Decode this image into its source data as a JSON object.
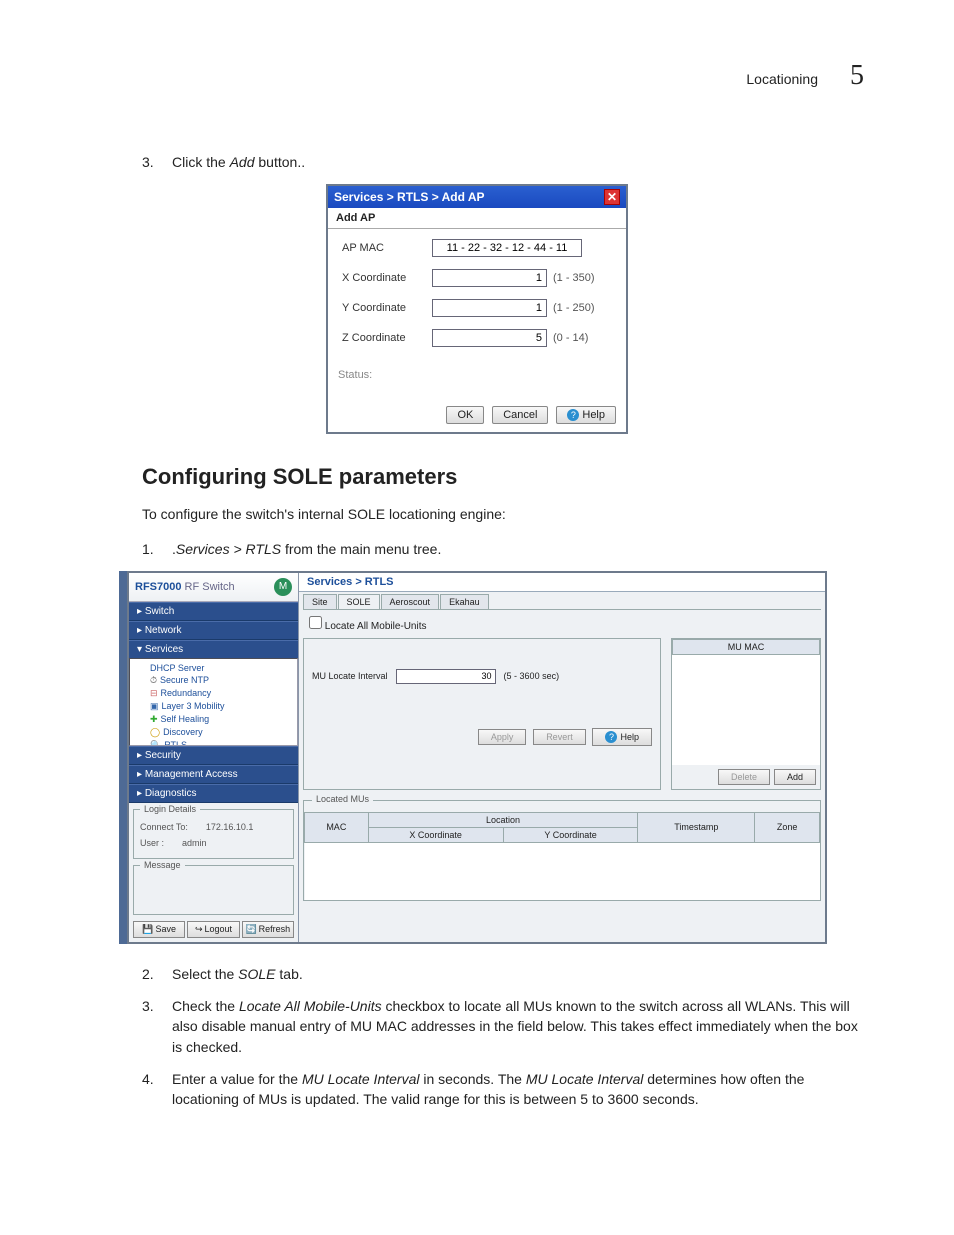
{
  "page_header": {
    "section": "Locationing",
    "chapter": "5"
  },
  "step3": {
    "num": "3.",
    "pre": "Click the ",
    "em": "Add",
    "post": " button.."
  },
  "dialog1": {
    "breadcrumb": "Services  > RTLS  > Add AP",
    "subtitle": "Add AP",
    "rows": {
      "mac": {
        "label": "AP MAC",
        "value": "11 - 22 - 32 - 12 - 44 - 11"
      },
      "x": {
        "label": "X Coordinate",
        "value": "1",
        "hint": "(1 - 350)"
      },
      "y": {
        "label": "Y Coordinate",
        "value": "1",
        "hint": "(1 - 250)"
      },
      "z": {
        "label": "Z Coordinate",
        "value": "5",
        "hint": "(0 - 14)"
      }
    },
    "status_label": "Status:",
    "buttons": {
      "ok": "OK",
      "cancel": "Cancel",
      "help": "Help"
    }
  },
  "heading": "Configuring SOLE parameters",
  "intro": "To configure the switch's internal SOLE locationing engine:",
  "step1": {
    "num": "1.",
    "pre": ".",
    "em": "Services > RTLS",
    "post": " from the main menu tree."
  },
  "panel2": {
    "brand1": "RFS7000",
    "brand2": " RF Switch",
    "nav": {
      "switch": "Switch",
      "network": "Network",
      "services": "Services",
      "security": "Security",
      "mgmt": "Management Access",
      "diag": "Diagnostics"
    },
    "tree": [
      "DHCP Server",
      "Secure NTP",
      "Redundancy",
      "Layer 3 Mobility",
      "Self Healing",
      "Discovery",
      "RTLS"
    ],
    "login": {
      "legend": "Login Details",
      "connect_lbl": "Connect To:",
      "connect_val": "172.16.10.1",
      "user_lbl": "User :",
      "user_val": "admin"
    },
    "message_legend": "Message",
    "footer": {
      "save": "Save",
      "logout": "Logout",
      "refresh": "Refresh"
    },
    "crumb": "Services > RTLS",
    "tabs": [
      "Site",
      "SOLE",
      "Aeroscout",
      "Ekahau"
    ],
    "locate_all": "Locate All Mobile-Units",
    "mu_mac_hdr": "MU MAC",
    "mu_buttons": {
      "delete": "Delete",
      "add": "Add"
    },
    "interval": {
      "label": "MU Locate Interval",
      "value": "30",
      "hint": "(5 - 3600 sec)"
    },
    "apply_row": {
      "apply": "Apply",
      "revert": "Revert",
      "help": "Help"
    },
    "located_legend": "Located MUs",
    "loc_headers": {
      "mac": "MAC",
      "location": "Location",
      "x": "X Coordinate",
      "y": "Y Coordinate",
      "timestamp": "Timestamp",
      "zone": "Zone"
    }
  },
  "step2b": {
    "num": "2.",
    "pre": "Select the ",
    "em": "SOLE",
    "post": " tab."
  },
  "step3b": {
    "num": "3.",
    "pre": "Check the ",
    "em": "Locate All Mobile-Units",
    "post": " checkbox to locate all MUs known to the switch across all WLANs. This will also disable manual entry of MU MAC addresses in the field below. This takes effect immediately when the box is checked."
  },
  "step4b": {
    "num": "4.",
    "pre": "Enter a value for the ",
    "em1": "MU Locate Interval",
    "mid": " in seconds. The ",
    "em2": "MU Locate Interval",
    "post": " determines how often the locationing of MUs is updated. The valid range for this is between 5 to 3600 seconds."
  }
}
